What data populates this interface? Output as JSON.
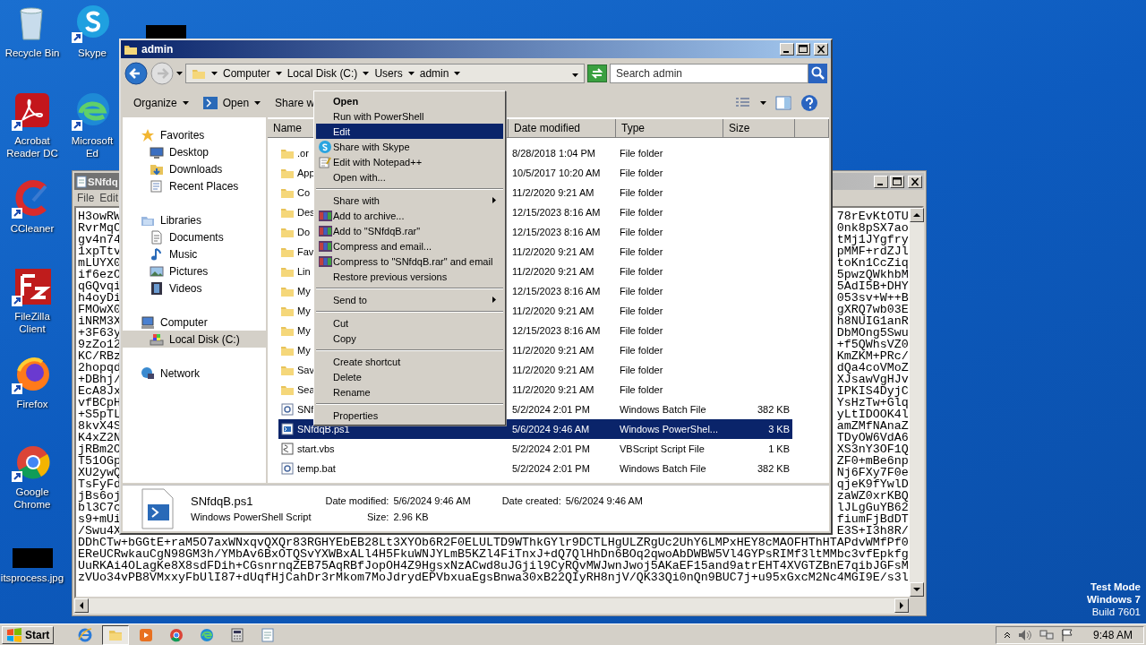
{
  "desktop": {
    "icons": [
      {
        "label": "Recycle Bin",
        "kind": "recycle"
      },
      {
        "label": "Acrobat Reader DC",
        "kind": "acrobat"
      },
      {
        "label": "CCleaner",
        "kind": "ccleaner"
      },
      {
        "label": "FileZilla Client",
        "kind": "filezilla"
      },
      {
        "label": "Firefox",
        "kind": "firefox"
      },
      {
        "label": "Google Chrome",
        "kind": "chrome"
      },
      {
        "label": "itsprocess.jpg",
        "kind": "redacted"
      },
      {
        "label": "Skype",
        "kind": "skype"
      },
      {
        "label": "Microsoft Ed",
        "kind": "edge"
      }
    ],
    "os_notice": [
      "Test Mode",
      "Windows 7",
      "Build 7601"
    ]
  },
  "notepad": {
    "title": "SNfdq",
    "menu": [
      "File",
      "Edit"
    ],
    "rows": [
      {
        "left": "H3owRW",
        "right": "78rEvKtOTU"
      },
      {
        "left": "RvrMqC",
        "right": "0nk8pSX7ao"
      },
      {
        "left": "gv4n74",
        "right": "tMj1JYgfry"
      },
      {
        "left": "1xpTtv",
        "right": "pMMF+rdZJl"
      },
      {
        "left": "mLUYX0",
        "right": "toKn1CcZiq"
      },
      {
        "left": "if6ezO",
        "right": "5pwzQWkhbM"
      },
      {
        "left": "qGQvqi",
        "right": "5AdI5B+DHY"
      },
      {
        "left": "h4oyDi",
        "right": "053sv+W++B"
      },
      {
        "left": "FMOwX0",
        "right": "gXRQ7wb03E"
      },
      {
        "left": "iNRM3X",
        "right": "h8NUIG1anR"
      },
      {
        "left": "+3F63y",
        "right": "DbMOng5Swu"
      },
      {
        "left": "9zZo12",
        "right": "+f5QWhsVZ0"
      },
      {
        "left": "KC/RBz",
        "right": "KmZKM+PRc/"
      },
      {
        "left": "2hopqd",
        "right": "dQa4coVMoZ"
      },
      {
        "left": "+DBhj/",
        "right": "XJsawVgHJv"
      },
      {
        "left": "EcA8Jx",
        "right": "IPKIS4DyjC"
      },
      {
        "left": "vfBCpH",
        "right": "YsHzTw+Glq"
      },
      {
        "left": "+S5pTL",
        "right": "yLtIDOOK4l"
      },
      {
        "left": "8kvX4S",
        "right": "amZMfNAnaZ"
      },
      {
        "left": "K4xZ2N",
        "right": "TDyOW6VdA6"
      },
      {
        "left": "jRBm2O",
        "right": "XS3nY3OF1Q"
      },
      {
        "left": "T51OGp",
        "right": "ZF0+mBe6np"
      },
      {
        "left": "XU2ywQ",
        "right": "Nj6FXy7F0e"
      },
      {
        "left": "TsFyFd",
        "right": "qjeK9fYwlD"
      },
      {
        "left": "jBs6oj",
        "right": "zaWZ0xrKBQ"
      },
      {
        "left": "bl3C7c",
        "right": "lJLgGuYB62"
      },
      {
        "left": "s9+mUi",
        "right": "fiumFjBdDT"
      },
      {
        "left": "/Swu4X",
        "right": "E3S+I3h8R/"
      }
    ],
    "lines": [
      "DDhCTw+bGGtE+raM5O7axWNxqvQXQr83RGHYEbEB28Lt3XYOb6R2F0ELULTD9WThkGYlr9DCTLHgULZRgUc2UhY6LMPxHEY8cMAOFHThHTAPdvWMfPf0",
      "EReUCRwkauCgN98GM3h/YMbAv6BxOTQSvYXWBxALl4H5FkuWNJYLmB5KZl4FiTnxJ+dQ7QlHhDn6BOq2qwoAbDWBW5Vl4GYPsRIMf3ltMMbc3vfEpkfg",
      "UuRKAi4OLagKe8X8sdFDih+CGsnrnqZEB75AqRBfJopOH4Z9HgsxNzACwd8uJGjil9CyRQvMWJwnJwoj5AKaEF15and9atrEHT4XVGTZBnE7qibJGFsM",
      "zVUo34vPB8VMxxyFbUlI87+dUqfHjCahDr3rMkom7MoJdrydEPVbxuaEgsBnwa30xB22QIyRH8njV/QK33Qi0nQn9BUC7j+u95xGxcM2Nc4MGI9E/s3l"
    ]
  },
  "explorer": {
    "title": "admin",
    "breadcrumbs": [
      "Computer",
      "Local Disk (C:)",
      "Users",
      "admin"
    ],
    "search": {
      "placeholder": "Search admin"
    },
    "toolbar": [
      {
        "label": "Organize",
        "kind": "menu"
      },
      {
        "label": "Open",
        "kind": "open"
      },
      {
        "label": "Share w",
        "kind": "plain"
      }
    ],
    "nav": [
      {
        "label": "Favorites",
        "kind": "star",
        "selected": false,
        "children": [
          {
            "label": "Desktop",
            "kind": "desktop",
            "selected": false
          },
          {
            "label": "Downloads",
            "kind": "downloads",
            "selected": false
          },
          {
            "label": "Recent Places",
            "kind": "recent",
            "selected": false
          }
        ]
      },
      {
        "label": "Libraries",
        "kind": "libraries",
        "selected": false,
        "children": [
          {
            "label": "Documents",
            "kind": "documents",
            "selected": false
          },
          {
            "label": "Music",
            "kind": "music",
            "selected": false
          },
          {
            "label": "Pictures",
            "kind": "pictures",
            "selected": false
          },
          {
            "label": "Videos",
            "kind": "videos",
            "selected": false
          }
        ]
      },
      {
        "label": "Computer",
        "kind": "computer",
        "selected": false,
        "children": [
          {
            "label": "Local Disk (C:)",
            "kind": "disk",
            "selected": true
          }
        ]
      },
      {
        "label": "Network",
        "kind": "network",
        "selected": false
      }
    ],
    "columns": [
      "Name",
      "Date modified",
      "Type",
      "Size"
    ],
    "files": [
      {
        "name": ".or",
        "date": "8/28/2018 1:04 PM",
        "type": "File folder",
        "kind": "folder",
        "selected": false
      },
      {
        "name": "App",
        "date": "10/5/2017 10:20 AM",
        "type": "File folder",
        "kind": "folder",
        "selected": false
      },
      {
        "name": "Co",
        "date": "11/2/2020 9:21 AM",
        "type": "File folder",
        "kind": "folder",
        "selected": false
      },
      {
        "name": "Des",
        "date": "12/15/2023 8:16 AM",
        "type": "File folder",
        "kind": "folder",
        "selected": false
      },
      {
        "name": "Do",
        "date": "12/15/2023 8:16 AM",
        "type": "File folder",
        "kind": "folder",
        "selected": false
      },
      {
        "name": "Fav",
        "date": "11/2/2020 9:21 AM",
        "type": "File folder",
        "kind": "folder",
        "selected": false
      },
      {
        "name": "Lin",
        "date": "11/2/2020 9:21 AM",
        "type": "File folder",
        "kind": "folder",
        "selected": false
      },
      {
        "name": "My",
        "date": "12/15/2023 8:16 AM",
        "type": "File folder",
        "kind": "folder",
        "selected": false
      },
      {
        "name": "My",
        "date": "11/2/2020 9:21 AM",
        "type": "File folder",
        "kind": "folder",
        "selected": false
      },
      {
        "name": "My",
        "date": "12/15/2023 8:16 AM",
        "type": "File folder",
        "kind": "folder",
        "selected": false
      },
      {
        "name": "My",
        "date": "11/2/2020 9:21 AM",
        "type": "File folder",
        "kind": "folder",
        "selected": false
      },
      {
        "name": "Sav",
        "date": "11/2/2020 9:21 AM",
        "type": "File folder",
        "kind": "folder",
        "selected": false
      },
      {
        "name": "Sea",
        "date": "11/2/2020 9:21 AM",
        "type": "File folder",
        "kind": "folder",
        "selected": false
      },
      {
        "name": "SNf",
        "date": "5/2/2024 2:01 PM",
        "type": "Windows Batch File",
        "size": "382 KB",
        "kind": "bat",
        "selected": false
      },
      {
        "name": "SNfdqB.ps1",
        "date": "5/6/2024 9:46 AM",
        "type": "Windows PowerShel...",
        "size": "3 KB",
        "kind": "ps1",
        "selected": true
      },
      {
        "name": "start.vbs",
        "date": "5/2/2024 2:01 PM",
        "type": "VBScript Script File",
        "size": "1 KB",
        "kind": "vbs",
        "selected": false
      },
      {
        "name": "temp.bat",
        "date": "5/2/2024 2:01 PM",
        "type": "Windows Batch File",
        "size": "382 KB",
        "kind": "bat",
        "selected": false
      }
    ],
    "details": {
      "name": "SNfdqB.ps1",
      "type": "Windows PowerShell Script",
      "fields": [
        {
          "label": "Date modified:",
          "value": "5/6/2024 9:46 AM"
        },
        {
          "label": "Date created:",
          "value": "5/6/2024 9:46 AM"
        },
        {
          "label": "Size:",
          "value": "2.96 KB"
        }
      ]
    }
  },
  "context_menu": {
    "items": [
      {
        "kind": "item",
        "label": "Open",
        "bold": true,
        "selected": false
      },
      {
        "kind": "item",
        "label": "Run with PowerShell",
        "bold": false,
        "selected": false
      },
      {
        "kind": "item",
        "label": "Edit",
        "bold": false,
        "selected": true
      },
      {
        "kind": "skype",
        "label": "Share with Skype",
        "bold": false,
        "selected": false
      },
      {
        "kind": "notepad",
        "label": "Edit with Notepad++",
        "bold": false,
        "selected": false
      },
      {
        "kind": "item",
        "label": "Open with...",
        "bold": false,
        "selected": false
      },
      {
        "kind": "separator"
      },
      {
        "kind": "item",
        "label": "Share with",
        "submenu": true,
        "bold": false,
        "selected": false
      },
      {
        "kind": "rar",
        "label": "Add to archive...",
        "bold": false,
        "selected": false
      },
      {
        "kind": "rar",
        "label": "Add to \"SNfdqB.rar\"",
        "bold": false,
        "selected": false
      },
      {
        "kind": "rar",
        "label": "Compress and email...",
        "bold": false,
        "selected": false
      },
      {
        "kind": "rar",
        "label": "Compress to \"SNfdqB.rar\" and email",
        "bold": false,
        "selected": false
      },
      {
        "kind": "item",
        "label": "Restore previous versions",
        "bold": false,
        "selected": false
      },
      {
        "kind": "separator"
      },
      {
        "kind": "item",
        "label": "Send to",
        "submenu": true,
        "bold": false,
        "selected": false
      },
      {
        "kind": "separator"
      },
      {
        "kind": "item",
        "label": "Cut",
        "bold": false,
        "selected": false
      },
      {
        "kind": "item",
        "label": "Copy",
        "bold": false,
        "selected": false
      },
      {
        "kind": "separator"
      },
      {
        "kind": "item",
        "label": "Create shortcut",
        "bold": false,
        "selected": false
      },
      {
        "kind": "item",
        "label": "Delete",
        "bold": false,
        "selected": false
      },
      {
        "kind": "item",
        "label": "Rename",
        "bold": false,
        "selected": false
      },
      {
        "kind": "separator"
      },
      {
        "kind": "item",
        "label": "Properties",
        "bold": false,
        "selected": false
      }
    ]
  },
  "taskbar": {
    "start": "Start",
    "apps": [
      {
        "kind": "ie",
        "selected": false
      },
      {
        "kind": "explorer",
        "selected": true
      },
      {
        "kind": "media",
        "selected": false
      },
      {
        "kind": "chrome",
        "selected": false
      },
      {
        "kind": "edge",
        "selected": false
      },
      {
        "kind": "app",
        "selected": false
      },
      {
        "kind": "notepad",
        "selected": false
      }
    ],
    "clock": "9:48 AM"
  }
}
